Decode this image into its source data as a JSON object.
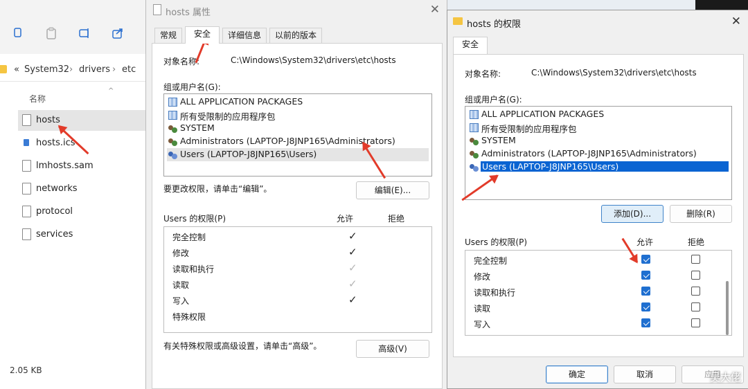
{
  "explorer": {
    "breadcrumb": [
      "«",
      "System32",
      "drivers",
      "etc"
    ],
    "column_header": "名称",
    "files": [
      "hosts",
      "hosts.ics",
      "lmhosts.sam",
      "networks",
      "protocol",
      "services"
    ],
    "status_size": "2.05 KB"
  },
  "props": {
    "title": "hosts 属性",
    "tabs": [
      "常规",
      "安全",
      "详细信息",
      "以前的版本"
    ],
    "object_label": "对象名称:",
    "object_value": "C:\\Windows\\System32\\drivers\\etc\\hosts",
    "groups_label": "组或用户名(G):",
    "groups": [
      "ALL APPLICATION PACKAGES",
      "所有受限制的应用程序包",
      "SYSTEM",
      "Administrators (LAPTOP-J8JNP165\\Administrators)",
      "Users (LAPTOP-J8JNP165\\Users)"
    ],
    "edit_hint": "要更改权限，请单击“编辑”。",
    "edit_button": "编辑(E)...",
    "perm_label": "Users 的权限(P)",
    "allow": "允许",
    "deny": "拒绝",
    "permissions": [
      "完全控制",
      "修改",
      "读取和执行",
      "读取",
      "写入",
      "特殊权限"
    ],
    "advanced_hint": "有关特殊权限或高级设置，请单击“高级”。",
    "advanced_button": "高级(V)"
  },
  "perms": {
    "title": "hosts 的权限",
    "tab": "安全",
    "object_label": "对象名称:",
    "object_value": "C:\\Windows\\System32\\drivers\\etc\\hosts",
    "groups_label": "组或用户名(G):",
    "groups": [
      "ALL APPLICATION PACKAGES",
      "所有受限制的应用程序包",
      "SYSTEM",
      "Administrators (LAPTOP-J8JNP165\\Administrators)",
      "Users (LAPTOP-J8JNP165\\Users)"
    ],
    "add_button": "添加(D)...",
    "remove_button": "删除(R)",
    "perm_label": "Users 的权限(P)",
    "allow": "允许",
    "deny": "拒绝",
    "permissions": [
      "完全控制",
      "修改",
      "读取和执行",
      "读取",
      "写入"
    ],
    "ok_button": "确定",
    "cancel_button": "取消",
    "apply_button": "应用"
  },
  "watermark": "吴大佬",
  "colors": {
    "arrow": "#e23b2a",
    "selection": "#0a64d2",
    "checkbox": "#1f6fd0"
  }
}
